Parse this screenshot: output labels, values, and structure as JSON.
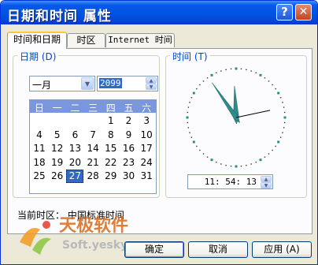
{
  "window": {
    "title": "日期和时间  属性"
  },
  "titlebar": {
    "help_label": "?",
    "close_label": "✕"
  },
  "tabs": [
    {
      "label": "时间和日期",
      "active": true
    },
    {
      "label": "时区",
      "active": false
    },
    {
      "label": "Internet 时间",
      "active": false
    }
  ],
  "date_group": {
    "legend": "日期 (D)",
    "month": "一月",
    "year": "2099",
    "weekday_headers": [
      "日",
      "一",
      "二",
      "三",
      "四",
      "五",
      "六"
    ],
    "days": [
      "1",
      "2",
      "3",
      "4",
      "5",
      "6",
      "7",
      "8",
      "9",
      "10",
      "11",
      "12",
      "13",
      "14",
      "15",
      "16",
      "17",
      "18",
      "19",
      "20",
      "21",
      "22",
      "23",
      "24",
      "25",
      "26",
      "27",
      "28",
      "29",
      "30",
      "31"
    ],
    "first_weekday_index": 4,
    "selected_day": "27"
  },
  "time_group": {
    "legend": "时间 (T)",
    "time": "11: 54: 13",
    "clock": {
      "hour": 11,
      "minute": 54,
      "second": 13
    }
  },
  "timezone": {
    "text": "当前时区：  中国标准时间"
  },
  "buttons": {
    "ok": "确定",
    "cancel": "取消",
    "apply": "应用 (A)"
  },
  "watermark": {
    "brand": "天极软件",
    "url": "Soft.yesky.com"
  },
  "colors": {
    "title_blue": "#0055e5",
    "selection": "#316ac5",
    "calendar_header": "#7a96df",
    "tab_highlight": "#ffc73c",
    "clock_hand": "#2e8b8b"
  }
}
